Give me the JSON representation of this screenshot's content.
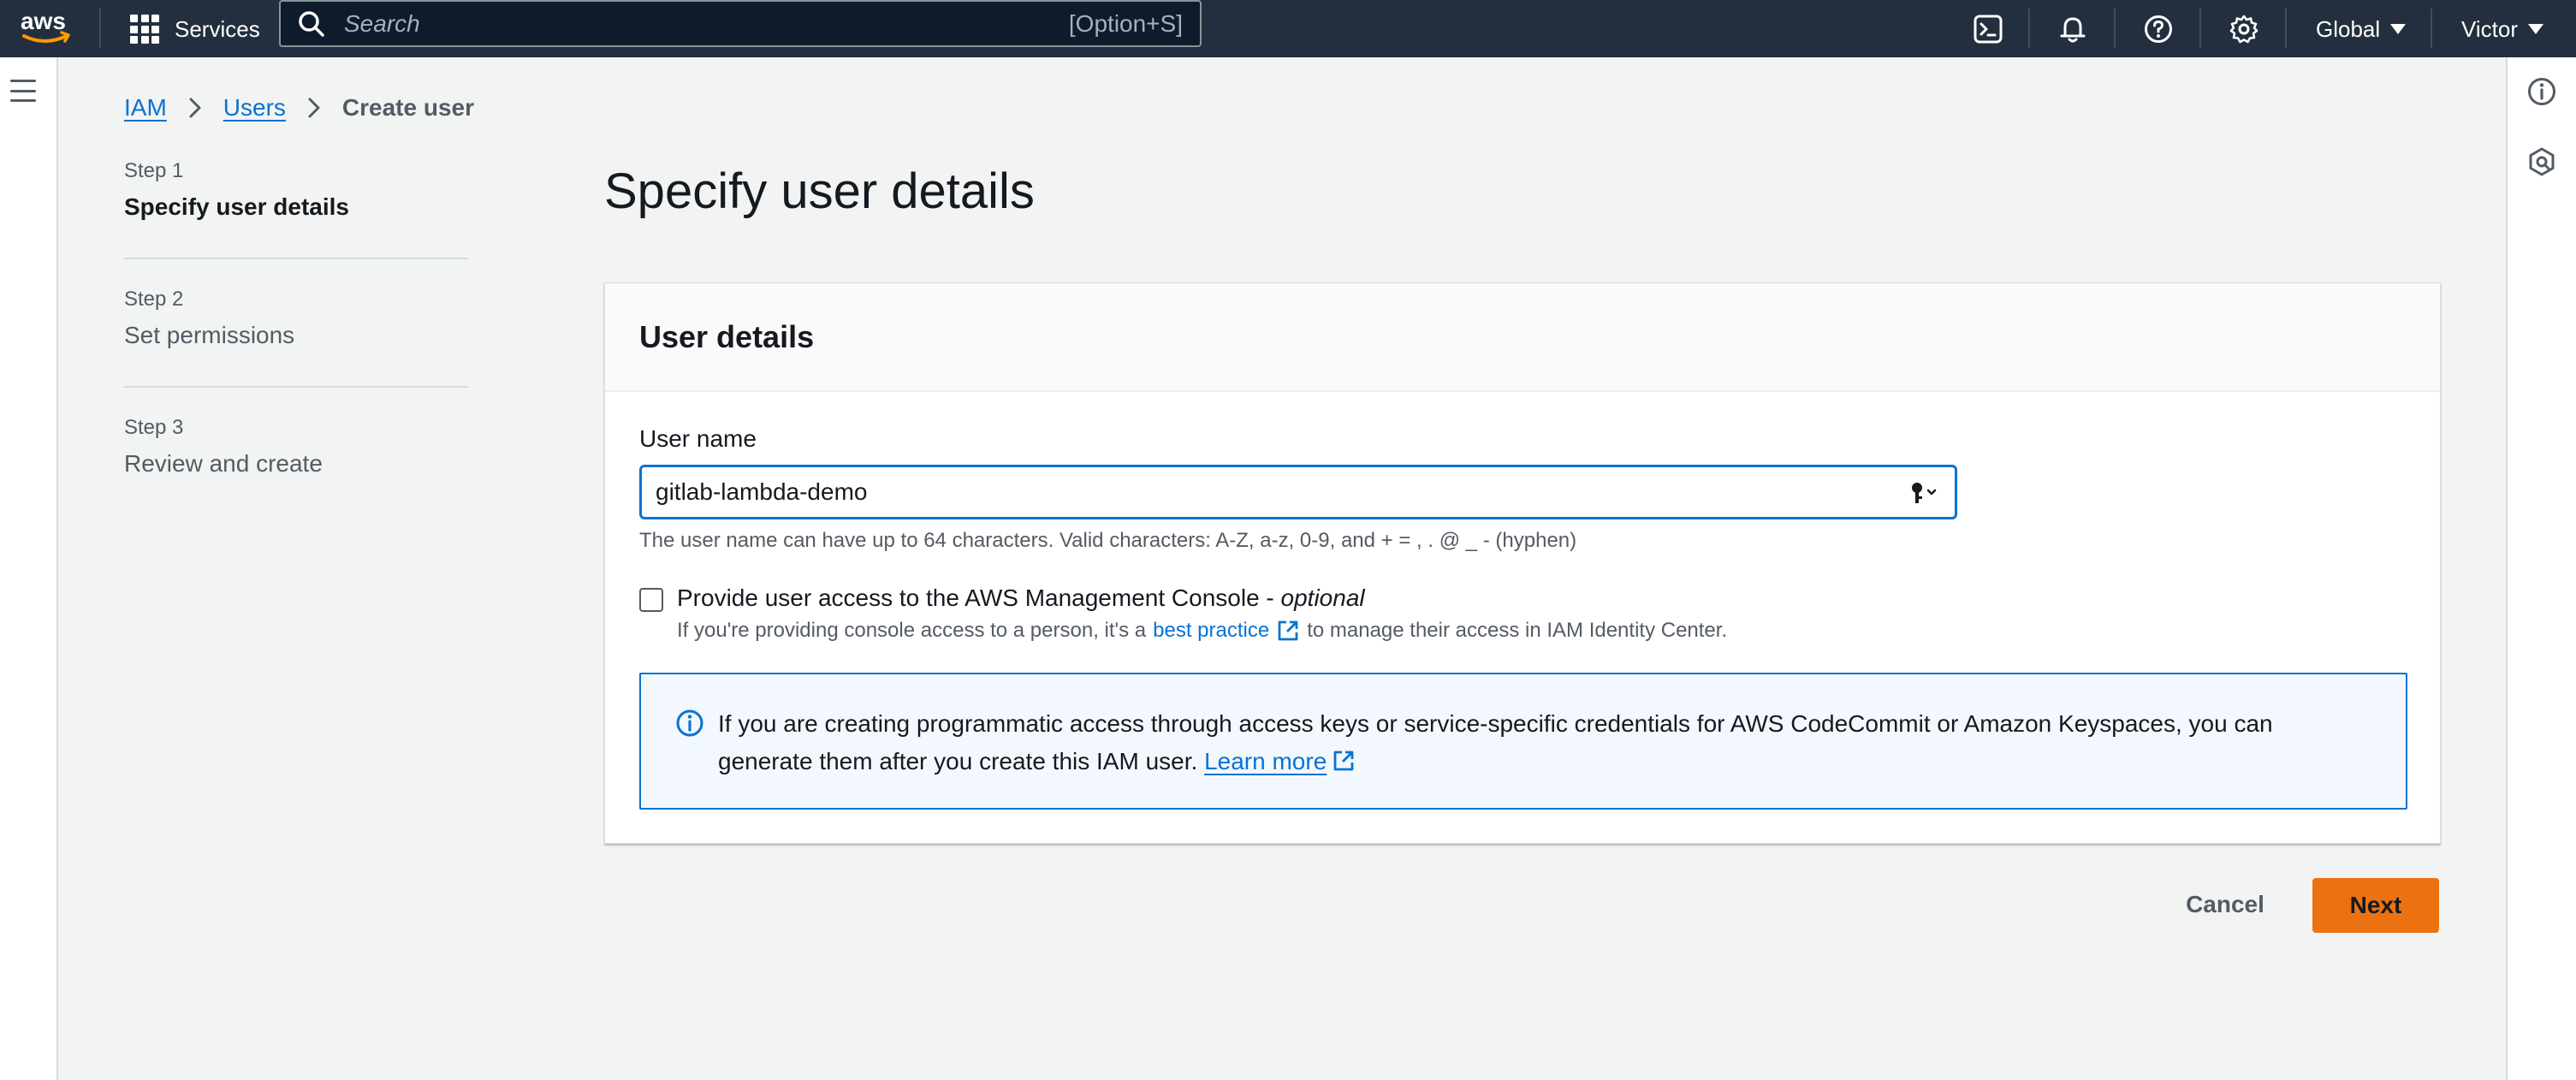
{
  "topnav": {
    "services_label": "Services",
    "search_placeholder": "Search",
    "search_shortcut": "[Option+S]",
    "region_label": "Global",
    "account_label": "Victor"
  },
  "breadcrumb": {
    "items": [
      "IAM",
      "Users"
    ],
    "current": "Create user"
  },
  "steps": [
    {
      "num": "Step 1",
      "title": "Specify user details",
      "active": true
    },
    {
      "num": "Step 2",
      "title": "Set permissions",
      "active": false
    },
    {
      "num": "Step 3",
      "title": "Review and create",
      "active": false
    }
  ],
  "main": {
    "page_title": "Specify user details",
    "panel_title": "User details",
    "username_label": "User name",
    "username_value": "gitlab-lambda-demo",
    "username_hint": "The user name can have up to 64 characters. Valid characters: A-Z, a-z, 0-9, and + = , . @ _ - (hyphen)",
    "console_access_label": "Provide user access to the AWS Management Console - ",
    "console_access_optional": "optional",
    "console_desc_prefix": "If you're providing console access to a person, it's a",
    "console_desc_link": "best practice",
    "console_desc_suffix": "to manage their access in IAM Identity Center.",
    "info_text": "If you are creating programmatic access through access keys or service-specific credentials for AWS CodeCommit or Amazon Keyspaces, you can generate them after you create this IAM user.",
    "info_link": "Learn more"
  },
  "actions": {
    "cancel_label": "Cancel",
    "next_label": "Next"
  },
  "colors": {
    "nav_bg": "#232f3e",
    "link": "#0972d3",
    "primary_button": "#ec7211",
    "page_bg": "#f2f3f3",
    "info_bg": "#f2f8fd"
  }
}
